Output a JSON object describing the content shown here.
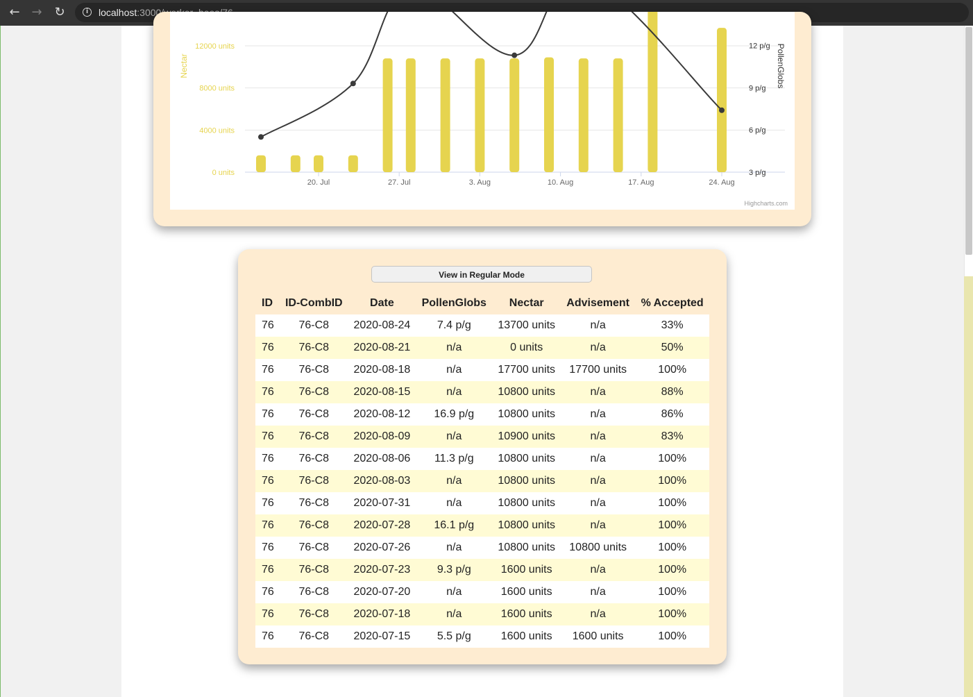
{
  "browser": {
    "url_host": "localhost",
    "url_path": ":3000/worker_bees/76",
    "back_icon": "arrow-left-icon",
    "forward_icon": "arrow-right-icon",
    "reload_icon": "reload-icon",
    "info_icon": "info-icon"
  },
  "colors": {
    "nectar": "#e6d44f",
    "pollen": "#3a3a3a",
    "card": "#feecd1",
    "row_alt": "#fffbd4"
  },
  "chart_data": {
    "type": "bar",
    "title": "",
    "credits": "Highcharts.com",
    "x_categories": [
      "20. Jul",
      "27. Jul",
      "3. Aug",
      "10. Aug",
      "17. Aug",
      "24. Aug"
    ],
    "y_left": {
      "label": "Nectar",
      "ticks": [
        "0 units",
        "4000 units",
        "8000 units",
        "12000 units"
      ],
      "range": [
        0,
        12000
      ]
    },
    "y_right": {
      "label": "PollenGlobs",
      "ticks": [
        "3 p/g",
        "6 p/g",
        "9 p/g",
        "12 p/g"
      ],
      "range": [
        3,
        12
      ]
    },
    "series": [
      {
        "name": "Nectar",
        "type": "column",
        "dates": [
          "2020-07-15",
          "2020-07-18",
          "2020-07-20",
          "2020-07-23",
          "2020-07-26",
          "2020-07-28",
          "2020-07-31",
          "2020-08-03",
          "2020-08-06",
          "2020-08-09",
          "2020-08-12",
          "2020-08-15",
          "2020-08-18",
          "2020-08-21",
          "2020-08-24"
        ],
        "values": [
          1600,
          1600,
          1600,
          1600,
          10800,
          10800,
          10800,
          10800,
          10800,
          10900,
          10800,
          10800,
          17700,
          0,
          13700
        ]
      },
      {
        "name": "PollenGlobs",
        "type": "spline",
        "dates": [
          "2020-07-15",
          "2020-07-23",
          "2020-07-28",
          "2020-08-06",
          "2020-08-12",
          "2020-08-24"
        ],
        "values": [
          5.5,
          9.3,
          16.1,
          11.3,
          16.9,
          7.4
        ]
      }
    ]
  },
  "table": {
    "mode_button": "View in Regular Mode",
    "headers": [
      "ID",
      "ID-CombID",
      "Date",
      "PollenGlobs",
      "Nectar",
      "Advisement",
      "% Accepted"
    ],
    "rows": [
      [
        "76",
        "76-C8",
        "2020-08-24",
        "7.4 p/g",
        "13700 units",
        "n/a",
        "33%"
      ],
      [
        "76",
        "76-C8",
        "2020-08-21",
        "n/a",
        "0 units",
        "n/a",
        "50%"
      ],
      [
        "76",
        "76-C8",
        "2020-08-18",
        "n/a",
        "17700 units",
        "17700 units",
        "100%"
      ],
      [
        "76",
        "76-C8",
        "2020-08-15",
        "n/a",
        "10800 units",
        "n/a",
        "88%"
      ],
      [
        "76",
        "76-C8",
        "2020-08-12",
        "16.9 p/g",
        "10800 units",
        "n/a",
        "86%"
      ],
      [
        "76",
        "76-C8",
        "2020-08-09",
        "n/a",
        "10900 units",
        "n/a",
        "83%"
      ],
      [
        "76",
        "76-C8",
        "2020-08-06",
        "11.3 p/g",
        "10800 units",
        "n/a",
        "100%"
      ],
      [
        "76",
        "76-C8",
        "2020-08-03",
        "n/a",
        "10800 units",
        "n/a",
        "100%"
      ],
      [
        "76",
        "76-C8",
        "2020-07-31",
        "n/a",
        "10800 units",
        "n/a",
        "100%"
      ],
      [
        "76",
        "76-C8",
        "2020-07-28",
        "16.1 p/g",
        "10800 units",
        "n/a",
        "100%"
      ],
      [
        "76",
        "76-C8",
        "2020-07-26",
        "n/a",
        "10800 units",
        "10800 units",
        "100%"
      ],
      [
        "76",
        "76-C8",
        "2020-07-23",
        "9.3 p/g",
        "1600 units",
        "n/a",
        "100%"
      ],
      [
        "76",
        "76-C8",
        "2020-07-20",
        "n/a",
        "1600 units",
        "n/a",
        "100%"
      ],
      [
        "76",
        "76-C8",
        "2020-07-18",
        "n/a",
        "1600 units",
        "n/a",
        "100%"
      ],
      [
        "76",
        "76-C8",
        "2020-07-15",
        "5.5 p/g",
        "1600 units",
        "1600 units",
        "100%"
      ]
    ]
  }
}
